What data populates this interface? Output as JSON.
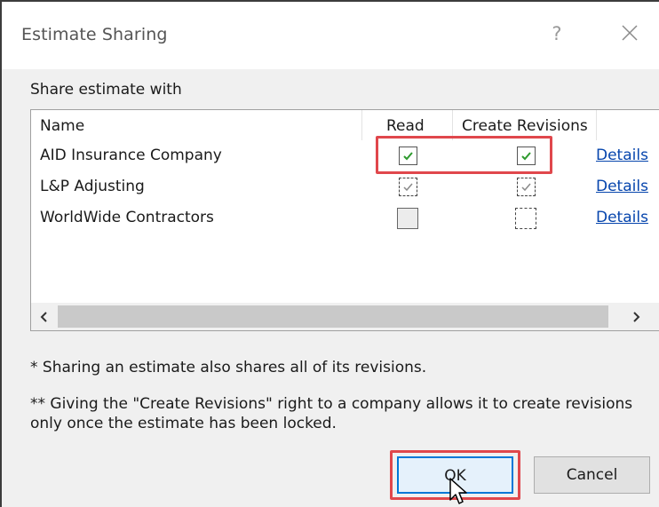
{
  "dialog": {
    "title": "Estimate Sharing",
    "help_glyph": "?",
    "close_icon": "close-icon"
  },
  "share_label": "Share estimate with",
  "list": {
    "columns": {
      "name": "Name",
      "read": "Read",
      "create_revisions": "Create Revisions"
    },
    "rows": [
      {
        "name": "AID Insurance Company",
        "read": "checked",
        "create_revisions": "checked",
        "details": "Details"
      },
      {
        "name": "L&P Adjusting",
        "read": "checked-indeterminate",
        "create_revisions": "checked-indeterminate",
        "details": "Details"
      },
      {
        "name": "WorldWide Contractors",
        "read": "unchecked-disabled",
        "create_revisions": "unchecked-dashed",
        "details": "Details"
      }
    ],
    "scroll_left_icon": "chevron-left-icon",
    "scroll_right_icon": "chevron-right-icon"
  },
  "notes": {
    "note1": "* Sharing an estimate also shares all of its revisions.",
    "note2_line1": "** Giving the \"Create Revisions\" right to a company allows it to create revisions",
    "note2_line2": "only once the estimate has been locked."
  },
  "buttons": {
    "ok": "OK",
    "cancel": "Cancel"
  },
  "colors": {
    "highlight": "#e0474c",
    "link": "#0645ad",
    "check": "#2e9a2e",
    "ok_border": "#0078d7"
  }
}
